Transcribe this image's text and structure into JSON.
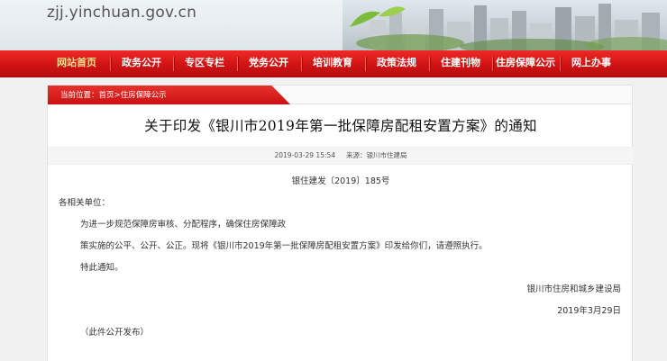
{
  "header": {
    "domain": "zjj.yinchuan.gov.cn"
  },
  "nav": {
    "items": [
      {
        "label": "网站首页",
        "active": true
      },
      {
        "label": "政务公开"
      },
      {
        "label": "专区专栏"
      },
      {
        "label": "党务公开"
      },
      {
        "label": "培训教育"
      },
      {
        "label": "政策法规"
      },
      {
        "label": "住建刊物"
      },
      {
        "label": "住房保障公示"
      },
      {
        "label": "网上办事"
      }
    ]
  },
  "breadcrumb": {
    "prefix": "当前位置：",
    "home": "首页",
    "sep": ">",
    "current": "住房保障公示"
  },
  "article": {
    "title": "关于印发《银川市2019年第一批保障房配租安置方案》的通知",
    "date": "2019-03-29 15:54",
    "source": "来源：银川市住建局",
    "doc_no": "银住建发〔2019〕185号",
    "salutation": "各相关单位：",
    "para1": "为进一步规范保障房审核、分配程序，确保住房保障政",
    "para2": "策实施的公平、公开、公正。现将《银川市2019年第一批保障房配租安置方案》印发给你们，请遵照执行。",
    "para3": "特此通知。",
    "signature_org": "银川市住房和城乡建设局",
    "signature_date": "2019年3月29日",
    "note": "（此件公开发布）"
  },
  "colors": {
    "nav_red": "#cf1414",
    "active_nav_text": "#ffe08a"
  }
}
